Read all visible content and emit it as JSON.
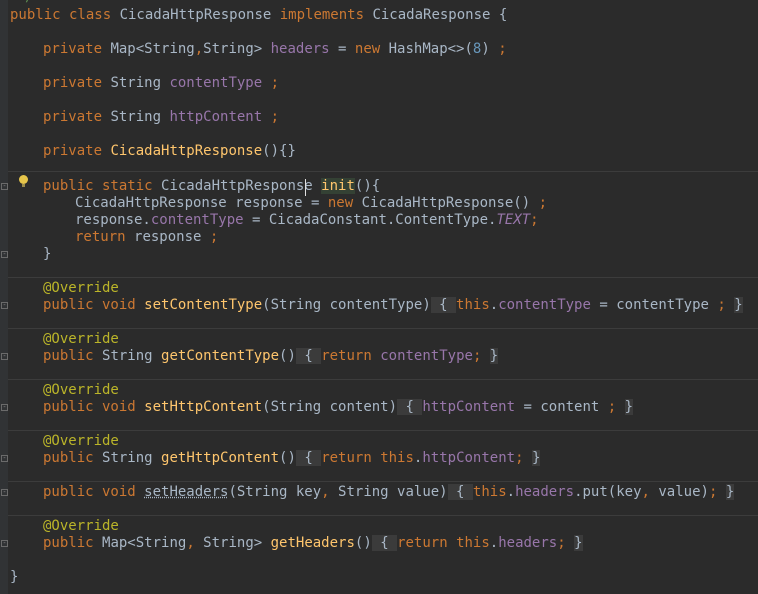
{
  "editor": {
    "lines": [
      "*/",
      "public class CicadaHttpResponse implements CicadaResponse {",
      "private Map<String,String> headers = new HashMap<>(8) ;",
      "private String contentType ;",
      "private String httpContent ;",
      "private CicadaHttpResponse(){}",
      "public static CicadaHttpResponse init(){",
      "CicadaHttpResponse response = new CicadaHttpResponse() ;",
      "response.contentType = CicadaConstant.ContentType.TEXT;",
      "return response ;",
      "}",
      "@Override",
      "public void setContentType(String contentType) { this.contentType = contentType ; }",
      "@Override",
      "public String getContentType() { return contentType; }",
      "@Override",
      "public void setHttpContent(String content) { httpContent = content ; }",
      "@Override",
      "public String getHttpContent() { return this.httpContent; }",
      "public void setHeaders(String key, String value) { this.headers.put(key, value); }",
      "@Override",
      "public Map<String, String> getHeaders() { return this.headers; }",
      "}"
    ],
    "colors": {
      "background": "#2b2b2b",
      "keyword": "#cc7832",
      "field": "#9876aa",
      "method": "#ffc66d",
      "annotation": "#bbb529",
      "number": "#6897bb",
      "text": "#a9b7c6"
    },
    "icons": [
      "intention-bulb-icon",
      "fold-marker-icon"
    ]
  }
}
